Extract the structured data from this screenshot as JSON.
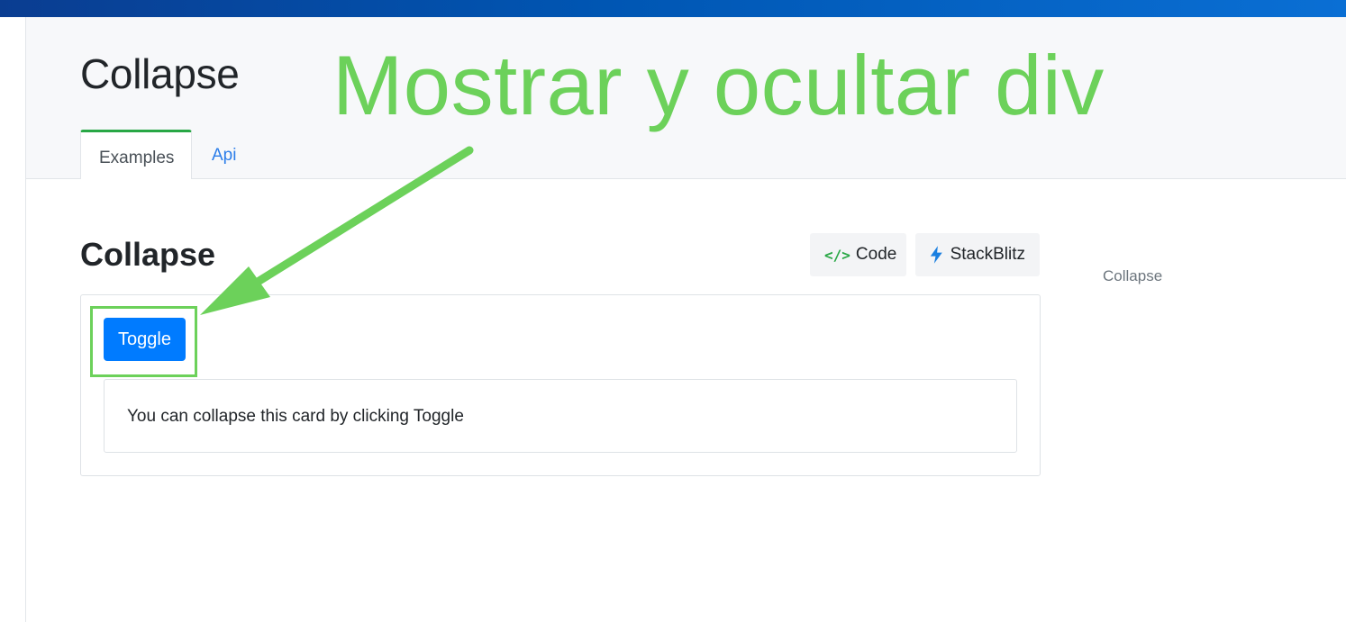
{
  "header": {
    "title": "Collapse",
    "annotation": "Mostrar y ocultar div",
    "tabs": [
      {
        "label": "Examples",
        "active": true
      },
      {
        "label": "Api",
        "active": false
      }
    ]
  },
  "section": {
    "title": "Collapse",
    "code_button": {
      "icon": "code-icon",
      "label": "Code"
    },
    "stackblitz_button": {
      "icon": "lightning-icon",
      "label": "StackBlitz"
    }
  },
  "toc": {
    "items": [
      "Collapse"
    ]
  },
  "demo": {
    "toggle_label": "Toggle",
    "card_text": "You can collapse this card by clicking Toggle"
  },
  "colors": {
    "accent_blue": "#007bff",
    "annotation_green": "#6cd15a",
    "tab_active_border": "#28a745"
  }
}
